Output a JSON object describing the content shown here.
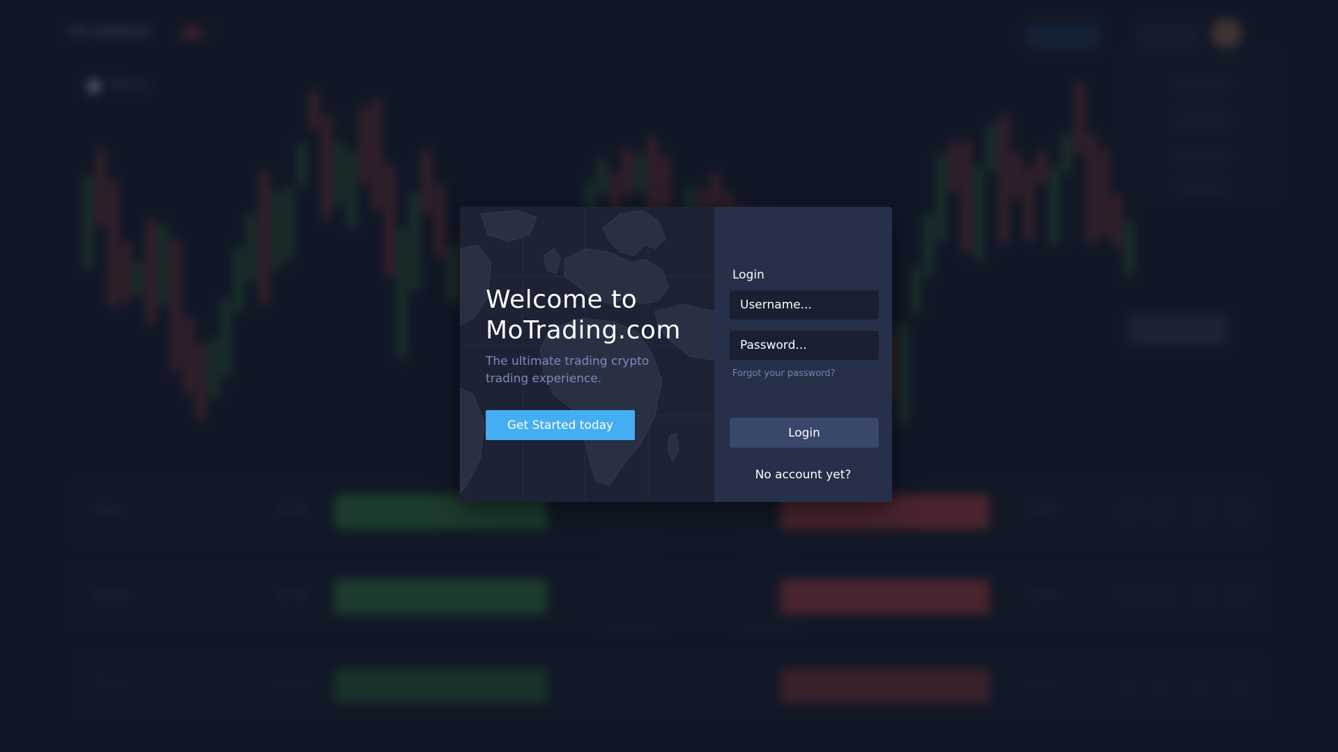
{
  "background": {
    "brand": "MO BINANCE",
    "asset": "Bitcoin",
    "rows": [
      {
        "label": "Taxel",
        "price": "$3.00",
        "price2": "$3.00"
      },
      {
        "label": "Rinne",
        "price": "$3.00",
        "price2": "$3.00"
      },
      {
        "label": "Tiyte",
        "price": "$3.00",
        "price2": "$3.00"
      }
    ]
  },
  "modal": {
    "welcome_title": "Welcome to MoTrading.com",
    "welcome_subtitle": "The ultimate trading crypto trading experience.",
    "get_started_label": "Get Started today",
    "login_heading": "Login",
    "username_placeholder": "Username...",
    "password_placeholder": "Password...",
    "forgot_password": "Forgot your password?",
    "login_button": "Login",
    "no_account": "No account yet?"
  },
  "colors": {
    "accent": "#45aef2",
    "modal_left_bg": "#1d2335",
    "modal_right_bg": "#263048",
    "login_button_bg": "#38476a",
    "candle_up": "#3a8f4a",
    "candle_down": "#c2464c"
  }
}
